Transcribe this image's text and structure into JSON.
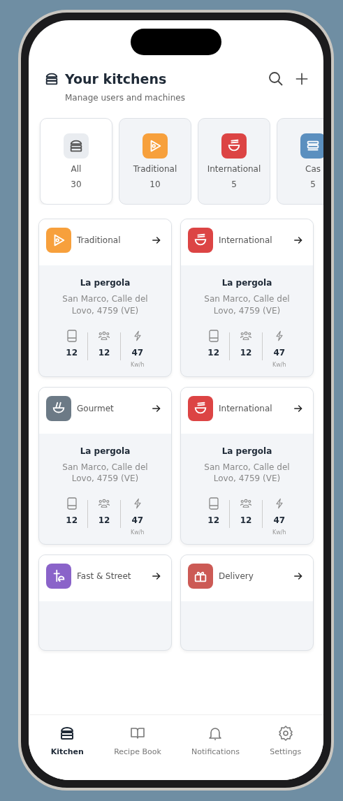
{
  "header": {
    "title": "Your kitchens",
    "subtitle": "Manage users and machines"
  },
  "categories": [
    {
      "label": "All",
      "count": "30",
      "kind": "store",
      "color": "#e9ecf0",
      "selected": true
    },
    {
      "label": "Traditional",
      "count": "10",
      "kind": "play",
      "color": "#f7a03c",
      "selected": false
    },
    {
      "label": "International",
      "count": "5",
      "kind": "bowl",
      "color": "#dc4444",
      "selected": false
    },
    {
      "label": "Cas",
      "count": "5",
      "kind": "lines",
      "color": "#5b8fbf",
      "selected": false
    }
  ],
  "kitchens": [
    {
      "category": "Traditional",
      "kind": "play",
      "color": "#f7a03c",
      "name": "La pergola",
      "address": "San Marco, Calle del Lovo, 4759 (VE)",
      "machines": "12",
      "users": "12",
      "energy": "47",
      "unit": "Kw/h"
    },
    {
      "category": "International",
      "kind": "bowl",
      "color": "#dc4444",
      "name": "La pergola",
      "address": "San Marco, Calle del Lovo, 4759 (VE)",
      "machines": "12",
      "users": "12",
      "energy": "47",
      "unit": "Kw/h"
    },
    {
      "category": "Gourmet",
      "kind": "pot",
      "color": "#6c7a86",
      "name": "La pergola",
      "address": "San Marco, Calle del Lovo, 4759 (VE)",
      "machines": "12",
      "users": "12",
      "energy": "47",
      "unit": "Kw/h"
    },
    {
      "category": "International",
      "kind": "bowl",
      "color": "#dc4444",
      "name": "La pergola",
      "address": "San Marco, Calle del Lovo, 4759 (VE)",
      "machines": "12",
      "users": "12",
      "energy": "47",
      "unit": "Kw/h"
    },
    {
      "category": "Fast & Street",
      "kind": "cup",
      "color": "#8a63c9"
    },
    {
      "category": "Delivery",
      "kind": "gift",
      "color": "#cc5a55"
    }
  ],
  "nav": [
    {
      "label": "Kitchen",
      "kind": "store",
      "selected": true
    },
    {
      "label": "Recipe Book",
      "kind": "book",
      "selected": false
    },
    {
      "label": "Notifications",
      "kind": "bell",
      "selected": false
    },
    {
      "label": "Settings",
      "kind": "gear",
      "selected": false
    }
  ]
}
